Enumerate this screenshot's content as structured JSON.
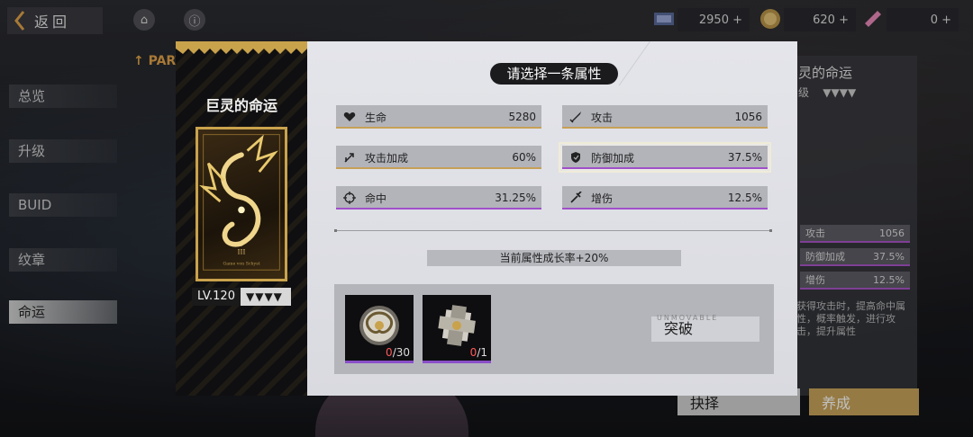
{
  "topbar": {
    "back_label": "返回",
    "home_icon": "home-icon",
    "info_icon": "info-icon",
    "resource_1": "2950",
    "resource_2": "620",
    "resource_3": "0"
  },
  "left_nav": {
    "part_tag": "PART",
    "items": [
      {
        "label": "总览"
      },
      {
        "label": "升级"
      },
      {
        "label": "BUID"
      },
      {
        "label": "纹章"
      },
      {
        "label": "命运"
      }
    ]
  },
  "background_panel": {
    "title": "灵的命运",
    "subtitle": "级",
    "stars": "▼▼▼▼",
    "stats": [
      {
        "name": "攻击",
        "value": "1056"
      },
      {
        "name": "防御加成",
        "value": "37.5%"
      },
      {
        "name": "增伤",
        "value": "12.5%"
      }
    ],
    "text": "获得攻击时，提高命中属性，概率触发，进行攻击，提升属性",
    "select_button": "抉择",
    "cultivate_button": "养成"
  },
  "card": {
    "title": "巨灵的命运",
    "numeral": "III",
    "subcaption": "Game von Schyst",
    "level": "LV.120",
    "stars": "▼▼▼▼"
  },
  "modal": {
    "title": "请选择一条属性",
    "stats": [
      {
        "icon": "heart-icon",
        "name": "生命",
        "value": "5280",
        "bar": "gold"
      },
      {
        "icon": "sword-icon",
        "name": "攻击",
        "value": "1056",
        "bar": "gold"
      },
      {
        "icon": "attack-boost-icon",
        "name": "攻击加成",
        "value": "60%",
        "bar": "gold"
      },
      {
        "icon": "shield-icon",
        "name": "防御加成",
        "value": "37.5%",
        "bar": "purple",
        "selected": true
      },
      {
        "icon": "crosshair-icon",
        "name": "命中",
        "value": "31.25%",
        "bar": "purple"
      },
      {
        "icon": "damage-boost-icon",
        "name": "增伤",
        "value": "12.5%",
        "bar": "purple"
      }
    ],
    "growth_text": "当前属性成长率+20%",
    "materials": [
      {
        "icon": "knot-emblem-icon",
        "have": "0",
        "need": "/30"
      },
      {
        "icon": "ornate-cross-icon",
        "have": "0",
        "need": "/1"
      }
    ],
    "break_button": "突破",
    "break_small": "UNMOVABLE"
  },
  "colors": {
    "gold": "#c6a057",
    "purple": "#a04fc9",
    "panel": "#e4e5ea",
    "stat_bg": "#b3b4ba"
  }
}
